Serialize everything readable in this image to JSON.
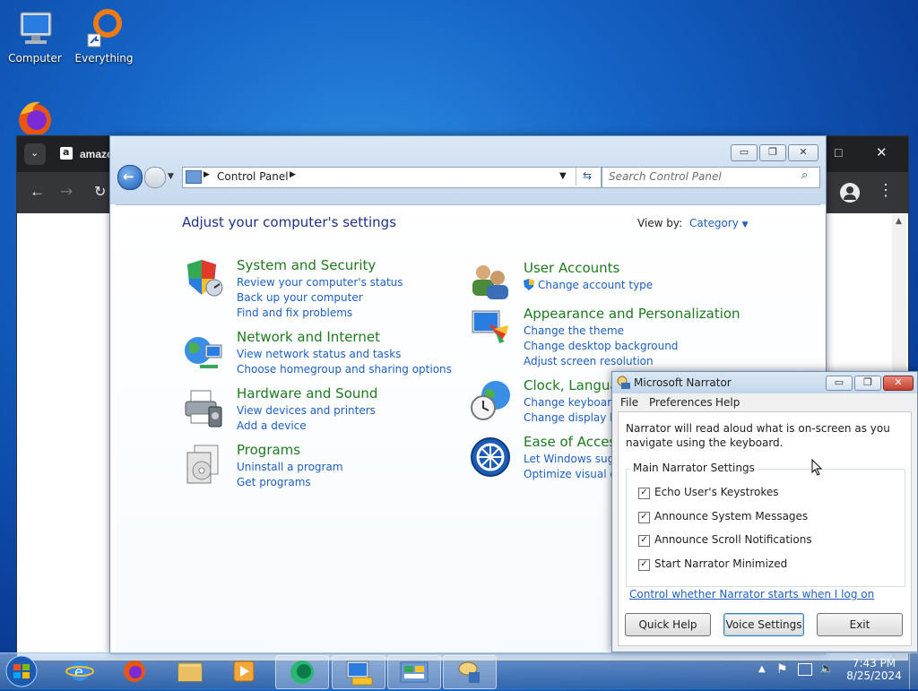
{
  "desktop": {
    "icons": [
      {
        "label": "Computer",
        "icon": "computer-icon"
      },
      {
        "label": "Everything",
        "icon": "everything-icon"
      },
      {
        "label": "",
        "icon": "firefox-icon"
      }
    ]
  },
  "browser": {
    "tab_title": "amazo"
  },
  "control_panel": {
    "breadcrumb": "Control Panel",
    "search_placeholder": "Search Control Panel",
    "heading": "Adjust your computer's settings",
    "view_by_label": "View by:",
    "view_by_value": "Category",
    "categories_left": [
      {
        "title": "System and Security",
        "icon": "shield-icon",
        "links": [
          "Review your computer's status",
          "Back up your computer",
          "Find and fix problems"
        ]
      },
      {
        "title": "Network and Internet",
        "icon": "network-icon",
        "links": [
          "View network status and tasks",
          "Choose homegroup and sharing options"
        ]
      },
      {
        "title": "Hardware and Sound",
        "icon": "printer-icon",
        "links": [
          "View devices and printers",
          "Add a device"
        ]
      },
      {
        "title": "Programs",
        "icon": "programs-icon",
        "links": [
          "Uninstall a program",
          "Get programs"
        ]
      }
    ],
    "categories_right": [
      {
        "title": "User Accounts",
        "icon": "users-icon",
        "links": [
          "Change account type"
        ]
      },
      {
        "title": "Appearance and Personalization",
        "icon": "appearance-icon",
        "links": [
          "Change the theme",
          "Change desktop background",
          "Adjust screen resolution"
        ]
      },
      {
        "title": "Clock, Languag",
        "icon": "clock-globe-icon",
        "links": [
          "Change keyboards",
          "Change display lan"
        ]
      },
      {
        "title": "Ease of Access",
        "icon": "ease-of-access-icon",
        "links": [
          "Let Windows sugge",
          "Optimize visual dis"
        ]
      }
    ]
  },
  "narrator": {
    "title": "Microsoft Narrator",
    "menu": [
      "File",
      "Preferences",
      "Help"
    ],
    "description": "Narrator will read aloud what is on-screen as you navigate using the keyboard.",
    "group_label": "Main Narrator Settings",
    "options": [
      {
        "label": "Echo User's Keystrokes",
        "checked": true
      },
      {
        "label": "Announce System Messages",
        "checked": true
      },
      {
        "label": "Announce Scroll Notifications",
        "checked": true
      },
      {
        "label": "Start Narrator Minimized",
        "checked": true
      }
    ],
    "link": "Control whether Narrator starts when I log on",
    "buttons": {
      "quick_help": "Quick Help",
      "voice_settings": "Voice Settings",
      "exit": "Exit"
    }
  },
  "taskbar": {
    "time": "7:43 PM",
    "date": "8/25/2024",
    "apps": [
      "internet-explorer-icon",
      "firefox-icon",
      "explorer-icon",
      "media-player-icon",
      "narrator-app-icon",
      "system-app-icon",
      "control-panel-app-icon",
      "speech-app-icon"
    ]
  },
  "colors": {
    "link": "#1e5fbf",
    "category": "#1e7a1e",
    "heading": "#1e3287"
  }
}
